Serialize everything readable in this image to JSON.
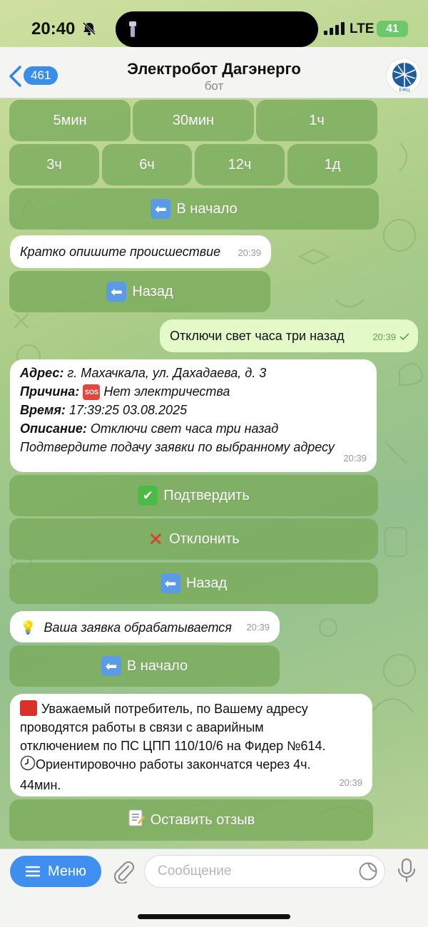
{
  "status_bar": {
    "time": "20:40",
    "network": "LTE",
    "battery": "41"
  },
  "header": {
    "back_count": "461",
    "title": "Электробот Дагэнерго",
    "subtitle": "бот",
    "avatar_text": "ЕЖЦ"
  },
  "keyboard_top": {
    "row1": [
      "5мин",
      "30мин",
      "1ч"
    ],
    "row2": [
      "3ч",
      "6ч",
      "12ч",
      "1д"
    ],
    "to_start": "В начало"
  },
  "messages": {
    "describe": {
      "text": "Кратко опишите происшествие",
      "time": "20:39"
    },
    "back_1": "Назад",
    "user_msg": {
      "text": "Отключи свет часа три назад",
      "time": "20:39"
    },
    "summary": {
      "address_label": "Адрес:",
      "address": "г. Махачкала, ул. Дахадаева, д. 3",
      "reason_label": "Причина:",
      "reason_emoji": "SOS",
      "reason": "Нет электричества",
      "time_label": "Время:",
      "time_value": "17:39:25 03.08.2025",
      "desc_label": "Описание:",
      "desc": "Отключи свет часа три назад",
      "confirm_prompt": "Подтвердите подачу заявки по выбранному адресу",
      "time": "20:39"
    },
    "confirm_btn": "Подтвердить",
    "decline_btn": "Отклонить",
    "back_2": "Назад",
    "processing": {
      "text": "Ваша заявка обрабатывается",
      "time": "20:39"
    },
    "to_start_2": "В начало",
    "notice": {
      "line1": "Уважаемый потребитель, по Вашему адресу",
      "line2": "проводятся работы в связи с аварийным",
      "line3": "отключением по ПС ЦПП 110/10/6 на Фидер №614.",
      "line4": "Ориентировочно работы закончатся через 4ч.",
      "line5": "44мин.",
      "time": "20:39"
    },
    "feedback_btn": "Оставить отзыв"
  },
  "input_bar": {
    "menu_label": "Меню",
    "placeholder": "Сообщение"
  },
  "colors": {
    "accent": "#3f8ff0",
    "outgoing_bubble": "#e4f9c8",
    "button_bg": "#78aa5a"
  }
}
